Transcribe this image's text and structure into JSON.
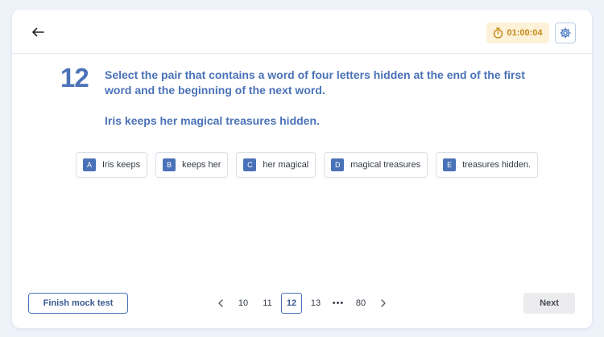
{
  "header": {
    "back_icon": "arrow-left-icon",
    "timer": {
      "icon": "stopwatch-icon",
      "value": "01:00:04",
      "color": "#c68a1a",
      "background": "#fdf1d8"
    },
    "settings_icon": "gear-icon"
  },
  "question": {
    "number": "12",
    "text": "Select the pair that contains a word of four letters hidden at the end of the first word and the beginning of the next word.",
    "sentence": "Iris keeps her magical treasures hidden."
  },
  "options": [
    {
      "letter": "A",
      "text": "Iris keeps"
    },
    {
      "letter": "B",
      "text": "keeps her"
    },
    {
      "letter": "C",
      "text": "her magical"
    },
    {
      "letter": "D",
      "text": "magical treasures"
    },
    {
      "letter": "E",
      "text": "treasures hidden."
    }
  ],
  "footer": {
    "finish_label": "Finish mock test",
    "pagination": {
      "prev_icon": "chevron-left-icon",
      "pages": [
        "10",
        "11",
        "12",
        "13"
      ],
      "current": "12",
      "ellipsis": "•••",
      "last": "80",
      "next_icon": "chevron-right-icon"
    },
    "next_label": "Next"
  },
  "colors": {
    "accent": "#4a72b8",
    "background": "#eef2f9"
  }
}
